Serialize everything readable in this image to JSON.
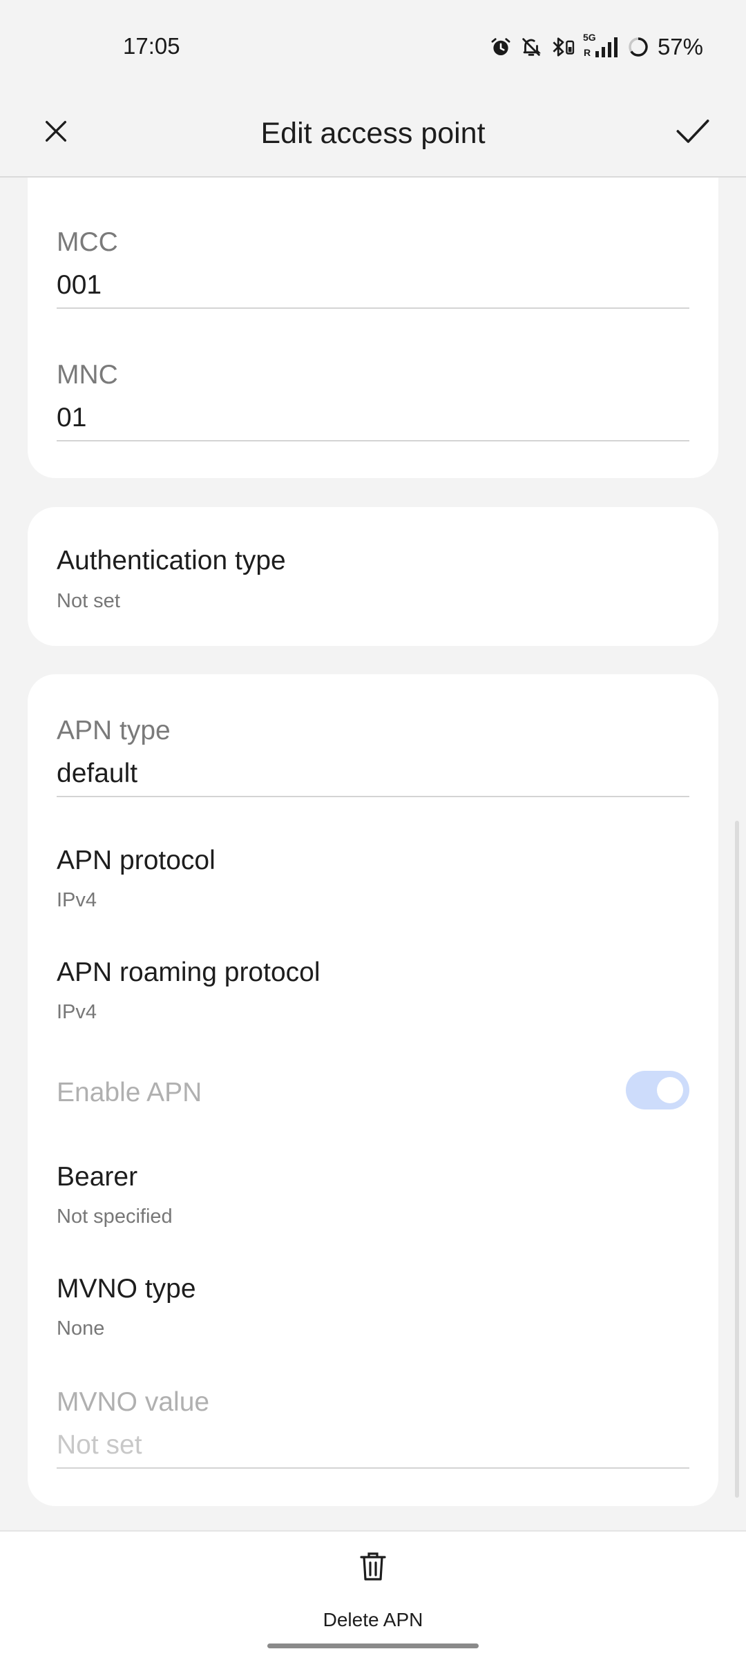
{
  "status_bar": {
    "time": "17:05",
    "network_label": "5G",
    "roaming_label": "R",
    "battery": "57%",
    "icons": [
      "alarm-icon",
      "mute-icon",
      "bluetooth-battery-icon",
      "signal-icon",
      "battery-ring-icon"
    ]
  },
  "app_bar": {
    "title": "Edit access point",
    "close_icon": "close-icon",
    "confirm_icon": "check-icon"
  },
  "fields": {
    "mcc": {
      "label": "MCC",
      "value": "001"
    },
    "mnc": {
      "label": "MNC",
      "value": "01"
    },
    "auth_type": {
      "title": "Authentication type",
      "summary": "Not set"
    },
    "apn_type": {
      "label": "APN type",
      "value": "default"
    },
    "apn_protocol": {
      "title": "APN protocol",
      "summary": "IPv4"
    },
    "apn_roaming_protocol": {
      "title": "APN roaming protocol",
      "summary": "IPv4"
    },
    "enable_apn": {
      "label": "Enable APN",
      "enabled": true
    },
    "bearer": {
      "title": "Bearer",
      "summary": "Not specified"
    },
    "mvno_type": {
      "title": "MVNO type",
      "summary": "None"
    },
    "mvno_value": {
      "label": "MVNO value",
      "placeholder": "Not set"
    }
  },
  "bottom": {
    "delete_label": "Delete APN",
    "delete_icon": "trash-icon"
  },
  "colors": {
    "background": "#f3f3f3",
    "card": "#ffffff",
    "toggle_track": "#cddcfb",
    "disabled_text": "#b0b0b0"
  }
}
